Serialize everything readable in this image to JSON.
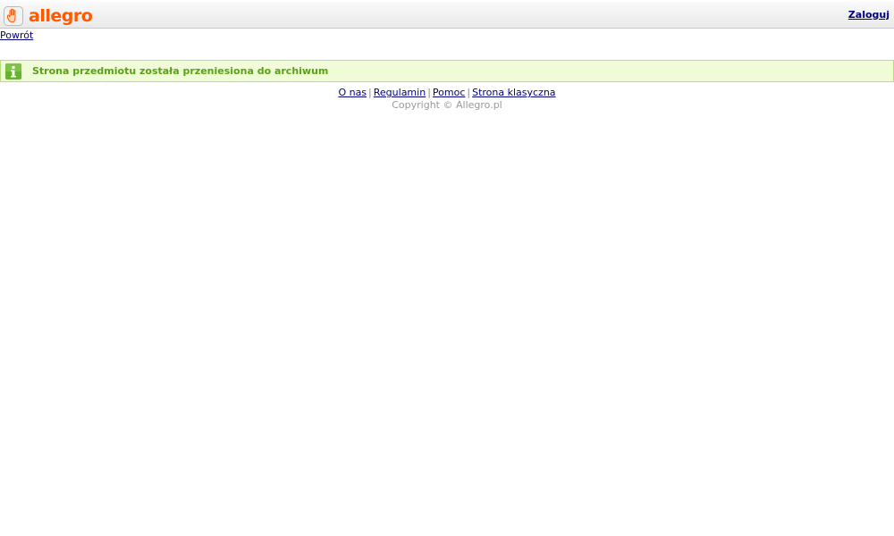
{
  "header": {
    "logo_text": "allegro",
    "logo_icon": "hand-icon",
    "login_label": "Zaloguj",
    "brand_color": "#ff5a00"
  },
  "nav": {
    "back_label": "Powrót"
  },
  "notice": {
    "icon": "info-icon",
    "message": "Strona przedmiotu została przeniesiona do archiwum",
    "text_color": "#58a213",
    "background": "#f0fbd8"
  },
  "footer": {
    "links": [
      "O nas",
      "Regulamin",
      "Pomoc",
      "Strona klasyczna"
    ],
    "separator": "|",
    "copyright": "Copyright © Allegro.pl"
  }
}
